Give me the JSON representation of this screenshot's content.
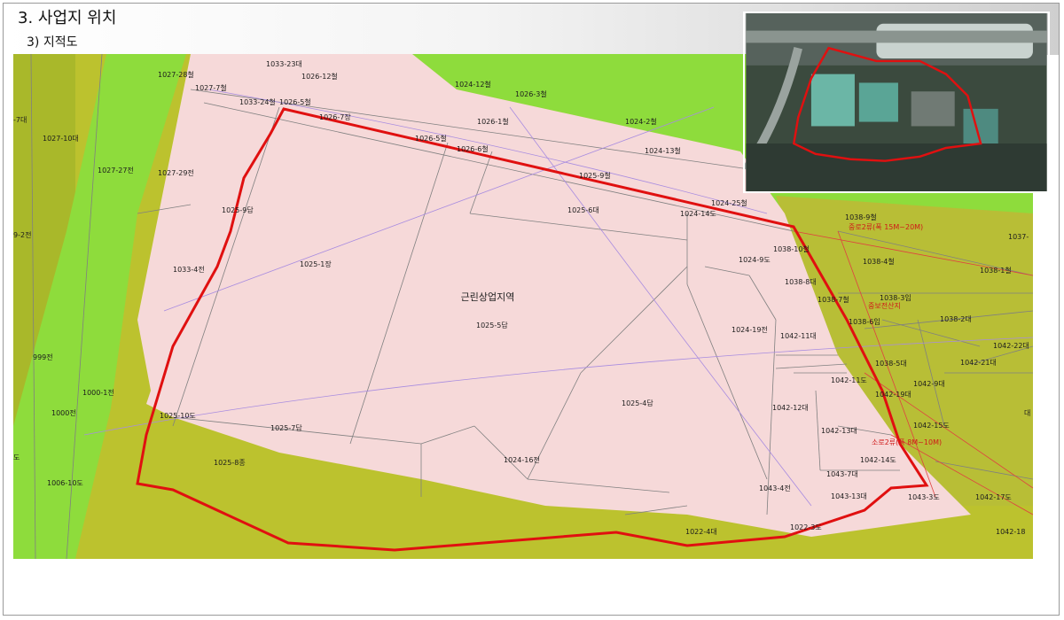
{
  "slide": {
    "title": "3. 사업지 위치",
    "subtitle": "3) 지적도"
  },
  "map": {
    "zone_label": "근린상업지역",
    "colors": {
      "site_boundary": "#e01010",
      "commercial_zone": "#f6d9d9",
      "green_zone": "#8edc3c",
      "olive_zone": "#bcc22e"
    },
    "road_labels": [
      "중로2류(폭 15M~20M)",
      "소로2류(폭 8M~10M)",
      "중보전산지"
    ],
    "parcels": [
      "1033-23대",
      "1026-12철",
      "1027-28철",
      "1027-7철",
      "1033-24철",
      "1026-5철",
      "1026-7장",
      "1024-12철",
      "1026-3철",
      "1026-1철",
      "1024-2철",
      "-7대",
      "1027-10대",
      "1026-5철",
      "1026-6철",
      "1024-13철",
      "1027-27전",
      "1027-29전",
      "1025-9철",
      "1025-9답",
      "1025-6대",
      "1024-25철",
      "1024-14도",
      "1038-9철",
      "1038-10철",
      "1024-9도",
      "1038-4철",
      "1037-",
      "9-2전",
      "1033-4전",
      "1025-1장",
      "1038-8대",
      "1038-1철",
      "1038-7철",
      "1038-3임",
      "1038-6임",
      "1038-2대",
      "1024-19전",
      "1042-11대",
      "1025-5답",
      "1042-22대",
      "999전",
      "1038-5대",
      "1042-21대",
      "1042-11도",
      "1042-9대",
      "1000-1전",
      "1042-19대",
      "1025-4답",
      "1042-12대",
      "1000전",
      "1025-10도",
      "1042-15도",
      "1042-13대",
      "1025-7답",
      "1042-14도",
      "1025-8종",
      "1024-16전",
      "1043-7대",
      "1006-10도",
      "1043-4전",
      "1043-13대",
      "1043-3도",
      "1042-17도",
      "1022-4대",
      "1022-3도",
      "1042-18",
      "도",
      "대"
    ]
  }
}
